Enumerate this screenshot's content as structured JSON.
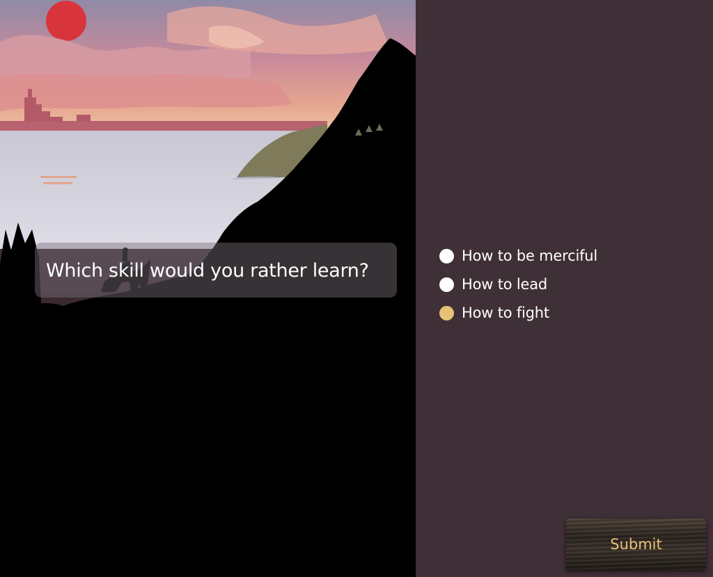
{
  "question": {
    "text": "Which skill would you rather learn?"
  },
  "options": [
    {
      "label": "How to be merciful",
      "selected": false
    },
    {
      "label": "How to lead",
      "selected": false
    },
    {
      "label": "How to fight",
      "selected": true
    }
  ],
  "submit": {
    "label": "Submit"
  },
  "colors": {
    "background": "#3f2f36",
    "accent": "#e6c276",
    "text": "#ffffff"
  }
}
